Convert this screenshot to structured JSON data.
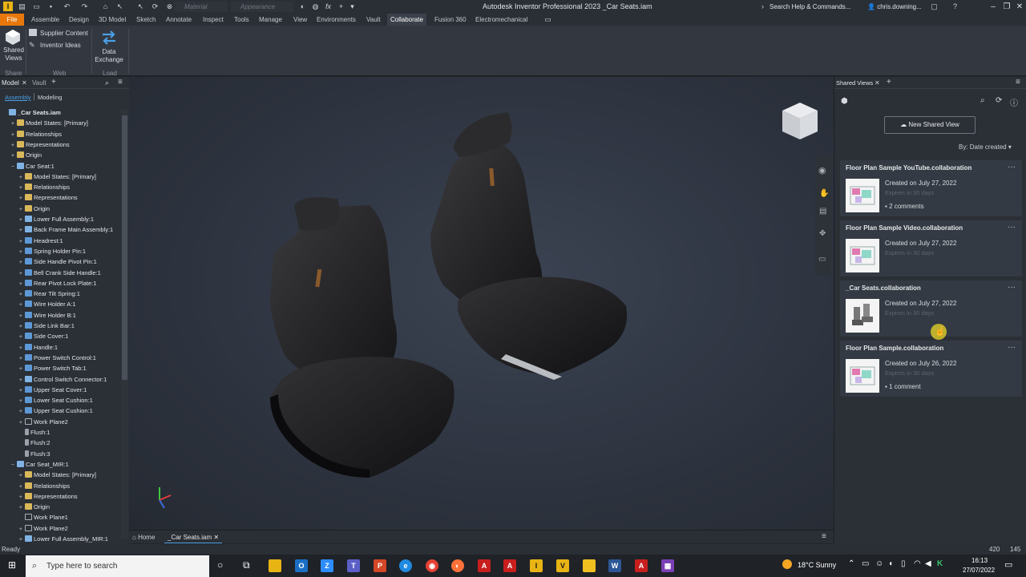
{
  "titlebar": {
    "title": "Autodesk Inventor Professional 2023   _Car Seats.iam",
    "material_placeholder": "Material",
    "appearance_placeholder": "Appearance",
    "help_search": "Search Help & Commands...",
    "user": "chris.downing..."
  },
  "ribbon_tabs": [
    "File",
    "Assemble",
    "Design",
    "3D Model",
    "Sketch",
    "Annotate",
    "Inspect",
    "Tools",
    "Manage",
    "View",
    "Environments",
    "Vault",
    "Collaborate",
    "Fusion 360",
    "Electromechanical"
  ],
  "ribbon": {
    "shared_views": "Shared\nViews",
    "supplier_content": "Supplier Content",
    "inventor_ideas": "Inventor Ideas",
    "data_exchange": "Data\nExchange",
    "groups": [
      "Share",
      "Web",
      "Load"
    ]
  },
  "browser": {
    "tab_model": "Model",
    "tab_vault": "Vault",
    "sub_assembly": "Assembly",
    "sub_modeling": "Modeling",
    "rows": [
      {
        "label": "_Car Seats.iam",
        "indent": 0,
        "icon": "asm",
        "exp": "",
        "bold": true
      },
      {
        "label": "Model States: [Primary]",
        "indent": 1,
        "icon": "folder",
        "exp": "+"
      },
      {
        "label": "Relationships",
        "indent": 1,
        "icon": "folder",
        "exp": "+"
      },
      {
        "label": "Representations",
        "indent": 1,
        "icon": "folder",
        "exp": "+"
      },
      {
        "label": "Origin",
        "indent": 1,
        "icon": "folder",
        "exp": "+"
      },
      {
        "label": "Car Seat:1",
        "indent": 1,
        "icon": "asm",
        "exp": "−"
      },
      {
        "label": "Model States: [Primary]",
        "indent": 2,
        "icon": "folder",
        "exp": "+"
      },
      {
        "label": "Relationships",
        "indent": 2,
        "icon": "folder",
        "exp": "+"
      },
      {
        "label": "Representations",
        "indent": 2,
        "icon": "folder",
        "exp": "+"
      },
      {
        "label": "Origin",
        "indent": 2,
        "icon": "folder",
        "exp": "+"
      },
      {
        "label": "Lower Full Assembly:1",
        "indent": 2,
        "icon": "asm",
        "exp": "+"
      },
      {
        "label": "Back Frame Main Assembly:1",
        "indent": 2,
        "icon": "asm",
        "exp": "+"
      },
      {
        "label": "Headrest:1",
        "indent": 2,
        "icon": "part",
        "exp": "+"
      },
      {
        "label": "Spring Holder Pin:1",
        "indent": 2,
        "icon": "part",
        "exp": "+"
      },
      {
        "label": "Side Handle Pivot Pin:1",
        "indent": 2,
        "icon": "part",
        "exp": "+"
      },
      {
        "label": "Bell Crank Side Handle:1",
        "indent": 2,
        "icon": "part",
        "exp": "+"
      },
      {
        "label": "Rear Pivot Lock Plate:1",
        "indent": 2,
        "icon": "part",
        "exp": "+"
      },
      {
        "label": "Rear Tilt Spring:1",
        "indent": 2,
        "icon": "part",
        "exp": "+"
      },
      {
        "label": "Wire Holder A:1",
        "indent": 2,
        "icon": "part",
        "exp": "+"
      },
      {
        "label": "Wire Holder B:1",
        "indent": 2,
        "icon": "part",
        "exp": "+"
      },
      {
        "label": "Side Link Bar:1",
        "indent": 2,
        "icon": "part",
        "exp": "+"
      },
      {
        "label": "Side Cover:1",
        "indent": 2,
        "icon": "part",
        "exp": "+"
      },
      {
        "label": "Handle:1",
        "indent": 2,
        "icon": "part",
        "exp": "+"
      },
      {
        "label": "Power Switch Control:1",
        "indent": 2,
        "icon": "part",
        "exp": "+"
      },
      {
        "label": "Power Switch Tab:1",
        "indent": 2,
        "icon": "part",
        "exp": "+"
      },
      {
        "label": "Control Switch Connector:1",
        "indent": 2,
        "icon": "asm",
        "exp": "+"
      },
      {
        "label": "Upper Seat Cover:1",
        "indent": 2,
        "icon": "part",
        "exp": "+"
      },
      {
        "label": "Lower Seat Cushion:1",
        "indent": 2,
        "icon": "part",
        "exp": "+"
      },
      {
        "label": "Upper Seat Cushion:1",
        "indent": 2,
        "icon": "part",
        "exp": "+"
      },
      {
        "label": "Work Plane2",
        "indent": 2,
        "icon": "plane",
        "exp": "+"
      },
      {
        "label": "Flush:1",
        "indent": 2,
        "icon": "constraint",
        "exp": ""
      },
      {
        "label": "Flush:2",
        "indent": 2,
        "icon": "constraint",
        "exp": ""
      },
      {
        "label": "Flush:3",
        "indent": 2,
        "icon": "constraint",
        "exp": ""
      },
      {
        "label": "Car Seat_MIR:1",
        "indent": 1,
        "icon": "asm",
        "exp": "−"
      },
      {
        "label": "Model States: [Primary]",
        "indent": 2,
        "icon": "folder",
        "exp": "+"
      },
      {
        "label": "Relationships",
        "indent": 2,
        "icon": "folder",
        "exp": "+"
      },
      {
        "label": "Representations",
        "indent": 2,
        "icon": "folder",
        "exp": "+"
      },
      {
        "label": "Origin",
        "indent": 2,
        "icon": "folder",
        "exp": "+"
      },
      {
        "label": "Work Plane1",
        "indent": 2,
        "icon": "plane",
        "exp": ""
      },
      {
        "label": "Work Plane2",
        "indent": 2,
        "icon": "plane",
        "exp": "+"
      },
      {
        "label": "Lower Full Assembly_MIR:1",
        "indent": 2,
        "icon": "asm",
        "exp": "+"
      }
    ]
  },
  "doc_tabs": {
    "home": "Home",
    "doc": "_Car Seats.iam"
  },
  "shared_views": {
    "panel_title": "Shared Views",
    "new_button": "New Shared View",
    "sort": "By: Date created",
    "cards": [
      {
        "title": "Floor Plan Sample YouTube.collaboration",
        "created": "Created on July 27, 2022",
        "expires": "Expires in 30 days",
        "comments": "2 comments"
      },
      {
        "title": "Floor Plan Sample Video.collaboration",
        "created": "Created on July 27, 2022",
        "expires": "Expires in 30 days",
        "comments": ""
      },
      {
        "title": "_Car Seats.collaboration",
        "created": "Created on July 27, 2022",
        "expires": "Expires in 30 days",
        "comments": ""
      },
      {
        "title": "Floor Plan Sample.collaboration",
        "created": "Created on July 26, 2022",
        "expires": "Expires in 30 days",
        "comments": "1 comment"
      }
    ]
  },
  "status": {
    "ready": "Ready",
    "num1": "420",
    "num2": "145"
  },
  "taskbar": {
    "search_placeholder": "Type here to search",
    "weather": "18°C  Sunny",
    "time": "16:13",
    "date": "27/07/2022"
  },
  "colors": {
    "file_tab": "#e8780c",
    "accent_yellow": "#e8b414"
  }
}
